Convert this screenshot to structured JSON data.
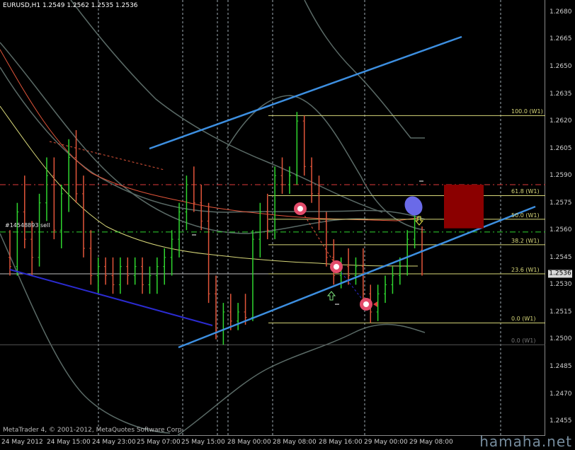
{
  "header": {
    "symbol_info": "EURUSD,H1  1.2549 1.2562 1.2535 1.2536"
  },
  "footer": {
    "copyright": "MetaTrader 4, © 2001-2012, MetaQuotes Software Corp."
  },
  "watermark": "hamaha.net",
  "current_price": "1.2536",
  "order_label": "#14548893 sell",
  "price_axis": [
    "1.2680",
    "1.2665",
    "1.2650",
    "1.2635",
    "1.2620",
    "1.2605",
    "1.2590",
    "1.2575",
    "1.2560",
    "1.2545",
    "1.2530",
    "1.2515",
    "1.2500",
    "1.2485",
    "1.2470",
    "1.2455"
  ],
  "time_axis": [
    "24 May 2012",
    "24 May 15:00",
    "24 May 23:00",
    "25 May 07:00",
    "25 May 15:00",
    "28 May 00:00",
    "28 May 08:00",
    "28 May 16:00",
    "29 May 00:00",
    "29 May 08:00"
  ],
  "fib_levels": [
    {
      "label": "100.0 (W1)",
      "price": 1.2623
    },
    {
      "label": "61.8 (W1)",
      "price": 1.2579
    },
    {
      "label": "50.0 (W1)",
      "price": 1.2566
    },
    {
      "label": "38.2 (W1)",
      "price": 1.2552
    },
    {
      "label": "23.6 (W1)",
      "price": 1.2536
    },
    {
      "label": "0.0 (W1)",
      "price": 1.2509
    },
    {
      "label": "0.0 (W1)",
      "price": 1.2497
    }
  ],
  "colors": {
    "bull": "#2fd62f",
    "bear": "#e2553a",
    "channel": "#3d8fe0",
    "fib": "#d7d779",
    "ma_orange": "#e2553a",
    "ma_yellow": "#d7d779",
    "ma_gray": "#5a6a66",
    "red_level": "#e03a3a",
    "green_level": "#2fd62f",
    "box": "#8b0000",
    "grid_dotted": "#c8d8e0"
  },
  "chart_data": {
    "type": "candlestick",
    "title": "EURUSD,H1",
    "timeframe": "H1",
    "ohlc_last": {
      "open": 1.2549,
      "high": 1.2562,
      "low": 1.2535,
      "close": 1.2536
    },
    "ylim": [
      1.245,
      1.2685
    ],
    "y_ticks": [
      1.268,
      1.2665,
      1.265,
      1.2635,
      1.262,
      1.2605,
      1.259,
      1.2575,
      1.256,
      1.2545,
      1.253,
      1.2515,
      1.25,
      1.2485,
      1.247,
      1.2455
    ],
    "x_tick_labels": [
      "24 May 2012",
      "24 May 15:00",
      "24 May 23:00",
      "25 May 07:00",
      "25 May 15:00",
      "28 May 00:00",
      "28 May 08:00",
      "28 May 16:00",
      "29 May 00:00",
      "29 May 08:00"
    ],
    "levels": {
      "red_dashed": 1.2585,
      "green_dashed": 1.2559,
      "current": 1.2536
    },
    "bars": [
      {
        "o": 1.2545,
        "h": 1.256,
        "l": 1.2535,
        "c": 1.254
      },
      {
        "o": 1.254,
        "h": 1.2575,
        "l": 1.2535,
        "c": 1.257
      },
      {
        "o": 1.257,
        "h": 1.259,
        "l": 1.255,
        "c": 1.2555
      },
      {
        "o": 1.2555,
        "h": 1.2565,
        "l": 1.2535,
        "c": 1.2545
      },
      {
        "o": 1.2545,
        "h": 1.258,
        "l": 1.254,
        "c": 1.2575
      },
      {
        "o": 1.2575,
        "h": 1.26,
        "l": 1.2565,
        "c": 1.259
      },
      {
        "o": 1.259,
        "h": 1.26,
        "l": 1.2555,
        "c": 1.256
      },
      {
        "o": 1.256,
        "h": 1.2585,
        "l": 1.255,
        "c": 1.258
      },
      {
        "o": 1.258,
        "h": 1.261,
        "l": 1.257,
        "c": 1.26
      },
      {
        "o": 1.26,
        "h": 1.2615,
        "l": 1.2575,
        "c": 1.258
      },
      {
        "o": 1.258,
        "h": 1.259,
        "l": 1.2545,
        "c": 1.255
      },
      {
        "o": 1.255,
        "h": 1.256,
        "l": 1.253,
        "c": 1.2535
      },
      {
        "o": 1.2535,
        "h": 1.2545,
        "l": 1.2525,
        "c": 1.254
      },
      {
        "o": 1.254,
        "h": 1.2545,
        "l": 1.253,
        "c": 1.2535
      },
      {
        "o": 1.2535,
        "h": 1.2545,
        "l": 1.2525,
        "c": 1.253
      },
      {
        "o": 1.253,
        "h": 1.2545,
        "l": 1.2525,
        "c": 1.254
      },
      {
        "o": 1.254,
        "h": 1.2545,
        "l": 1.253,
        "c": 1.2535
      },
      {
        "o": 1.2535,
        "h": 1.2545,
        "l": 1.253,
        "c": 1.254
      },
      {
        "o": 1.254,
        "h": 1.2545,
        "l": 1.2525,
        "c": 1.253
      },
      {
        "o": 1.253,
        "h": 1.254,
        "l": 1.2525,
        "c": 1.2535
      },
      {
        "o": 1.2535,
        "h": 1.2545,
        "l": 1.2525,
        "c": 1.254
      },
      {
        "o": 1.254,
        "h": 1.255,
        "l": 1.253,
        "c": 1.2545
      },
      {
        "o": 1.2545,
        "h": 1.256,
        "l": 1.2535,
        "c": 1.2555
      },
      {
        "o": 1.2555,
        "h": 1.2575,
        "l": 1.2545,
        "c": 1.257
      },
      {
        "o": 1.257,
        "h": 1.259,
        "l": 1.256,
        "c": 1.2585
      },
      {
        "o": 1.2585,
        "h": 1.2595,
        "l": 1.257,
        "c": 1.2575
      },
      {
        "o": 1.2575,
        "h": 1.2585,
        "l": 1.256,
        "c": 1.2565
      },
      {
        "o": 1.2565,
        "h": 1.2575,
        "l": 1.252,
        "c": 1.2525
      },
      {
        "o": 1.2525,
        "h": 1.2535,
        "l": 1.25,
        "c": 1.2505
      },
      {
        "o": 1.2505,
        "h": 1.252,
        "l": 1.2497,
        "c": 1.2515
      },
      {
        "o": 1.2515,
        "h": 1.2525,
        "l": 1.2505,
        "c": 1.251
      },
      {
        "o": 1.251,
        "h": 1.252,
        "l": 1.2505,
        "c": 1.2515
      },
      {
        "o": 1.2515,
        "h": 1.2525,
        "l": 1.2508,
        "c": 1.2512
      },
      {
        "o": 1.2512,
        "h": 1.256,
        "l": 1.251,
        "c": 1.2555
      },
      {
        "o": 1.2555,
        "h": 1.2575,
        "l": 1.2545,
        "c": 1.257
      },
      {
        "o": 1.257,
        "h": 1.258,
        "l": 1.2555,
        "c": 1.256
      },
      {
        "o": 1.256,
        "h": 1.2595,
        "l": 1.2555,
        "c": 1.259
      },
      {
        "o": 1.259,
        "h": 1.26,
        "l": 1.258,
        "c": 1.2585
      },
      {
        "o": 1.2585,
        "h": 1.2595,
        "l": 1.258,
        "c": 1.259
      },
      {
        "o": 1.259,
        "h": 1.2625,
        "l": 1.2585,
        "c": 1.262
      },
      {
        "o": 1.262,
        "h": 1.2623,
        "l": 1.259,
        "c": 1.2595
      },
      {
        "o": 1.2595,
        "h": 1.26,
        "l": 1.2575,
        "c": 1.258
      },
      {
        "o": 1.258,
        "h": 1.259,
        "l": 1.256,
        "c": 1.2565
      },
      {
        "o": 1.2565,
        "h": 1.257,
        "l": 1.254,
        "c": 1.2545
      },
      {
        "o": 1.2545,
        "h": 1.2555,
        "l": 1.253,
        "c": 1.2535
      },
      {
        "o": 1.2535,
        "h": 1.2545,
        "l": 1.2528,
        "c": 1.254
      },
      {
        "o": 1.254,
        "h": 1.255,
        "l": 1.253,
        "c": 1.2535
      },
      {
        "o": 1.2535,
        "h": 1.2545,
        "l": 1.253,
        "c": 1.254
      },
      {
        "o": 1.254,
        "h": 1.255,
        "l": 1.252,
        "c": 1.2525
      },
      {
        "o": 1.2525,
        "h": 1.253,
        "l": 1.2509,
        "c": 1.2515
      },
      {
        "o": 1.2515,
        "h": 1.253,
        "l": 1.251,
        "c": 1.2525
      },
      {
        "o": 1.2525,
        "h": 1.2535,
        "l": 1.252,
        "c": 1.253
      },
      {
        "o": 1.253,
        "h": 1.254,
        "l": 1.2525,
        "c": 1.2535
      },
      {
        "o": 1.2535,
        "h": 1.2545,
        "l": 1.253,
        "c": 1.254
      },
      {
        "o": 1.254,
        "h": 1.256,
        "l": 1.2535,
        "c": 1.2555
      },
      {
        "o": 1.2555,
        "h": 1.2575,
        "l": 1.255,
        "c": 1.257
      },
      {
        "o": 1.2549,
        "h": 1.2562,
        "l": 1.2535,
        "c": 1.2536
      }
    ]
  }
}
